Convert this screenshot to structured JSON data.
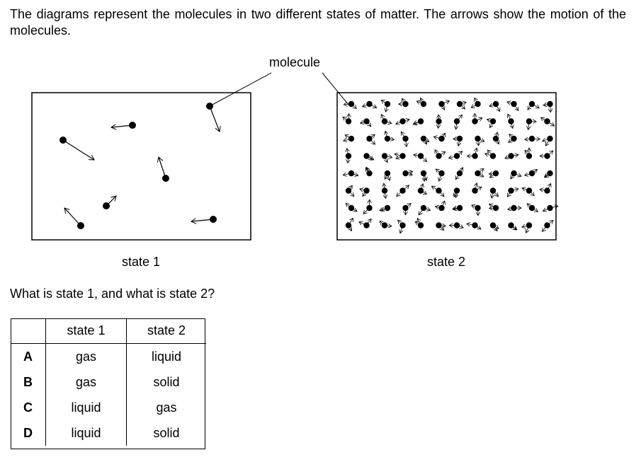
{
  "question": {
    "intro": "The diagrams represent the molecules in two different states of matter. The arrows show the motion of the molecules.",
    "ask": "What is state 1, and what is state 2?"
  },
  "diagram": {
    "molecule_label": "molecule",
    "state1_label": "state 1",
    "state2_label": "state 2"
  },
  "table": {
    "headers": [
      "",
      "state 1",
      "state 2"
    ],
    "rows": [
      {
        "letter": "A",
        "state1": "gas",
        "state2": "liquid"
      },
      {
        "letter": "B",
        "state1": "gas",
        "state2": "solid"
      },
      {
        "letter": "C",
        "state1": "liquid",
        "state2": "gas"
      },
      {
        "letter": "D",
        "state1": "liquid",
        "state2": "solid"
      }
    ]
  }
}
